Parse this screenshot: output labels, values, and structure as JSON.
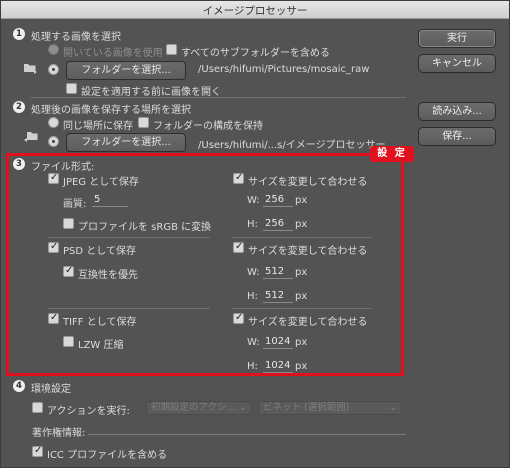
{
  "window": {
    "title": "イメージプロセッサー"
  },
  "buttons": {
    "run": "実行",
    "cancel": "キャンセル",
    "load": "読み込み...",
    "save": "保存..."
  },
  "section1": {
    "number": "1",
    "title": "処理する画像を選択",
    "use_open_images": "開いている画像を使用",
    "include_subfolders": "すべてのサブフォルダーを含める",
    "choose_folder": "フォルダーを選択...",
    "source_path": "/Users/hifumi/Pictures/mosaic_raw",
    "open_first_image": "設定を適用する前に画像を開く"
  },
  "section2": {
    "number": "2",
    "title": "処理後の画像を保存する場所を選択",
    "same_location": "同じ場所に保存",
    "keep_structure": "フォルダーの構成を保持",
    "choose_folder": "フォルダーを選択...",
    "dest_path": "/Users/hifumi/...s/イメージプロセッサー"
  },
  "section3": {
    "number": "3",
    "title": "ファイル形式:",
    "tag": "設 定",
    "jpeg": {
      "label": "JPEG として保存",
      "resize": "サイズを変更して合わせる",
      "quality_label": "画質:",
      "quality": "5",
      "convert_srgb": "プロファイルを sRGB に変換",
      "w_label": "W:",
      "w": "256",
      "w_unit": "px",
      "h_label": "H:",
      "h": "256",
      "h_unit": "px"
    },
    "psd": {
      "label": "PSD として保存",
      "resize": "サイズを変更して合わせる",
      "maximize": "互換性を優先",
      "w_label": "W:",
      "w": "512",
      "w_unit": "px",
      "h_label": "H:",
      "h": "512",
      "h_unit": "px"
    },
    "tiff": {
      "label": "TIFF として保存",
      "resize": "サイズを変更して合わせる",
      "lzw": "LZW 圧縮",
      "w_label": "W:",
      "w": "1024",
      "w_unit": "px",
      "h_label": "H:",
      "h": "1024",
      "h_unit": "px"
    }
  },
  "section4": {
    "number": "4",
    "title": "環境設定",
    "run_action": "アクションを実行:",
    "action_set": "初期設定のアクシ...",
    "action": "ビネット (選択範囲)",
    "copyright_label": "著作権情報:",
    "include_icc": "ICC プロファイルを含める"
  },
  "colors": {
    "highlight": "#e0101e",
    "background": "#535353"
  }
}
